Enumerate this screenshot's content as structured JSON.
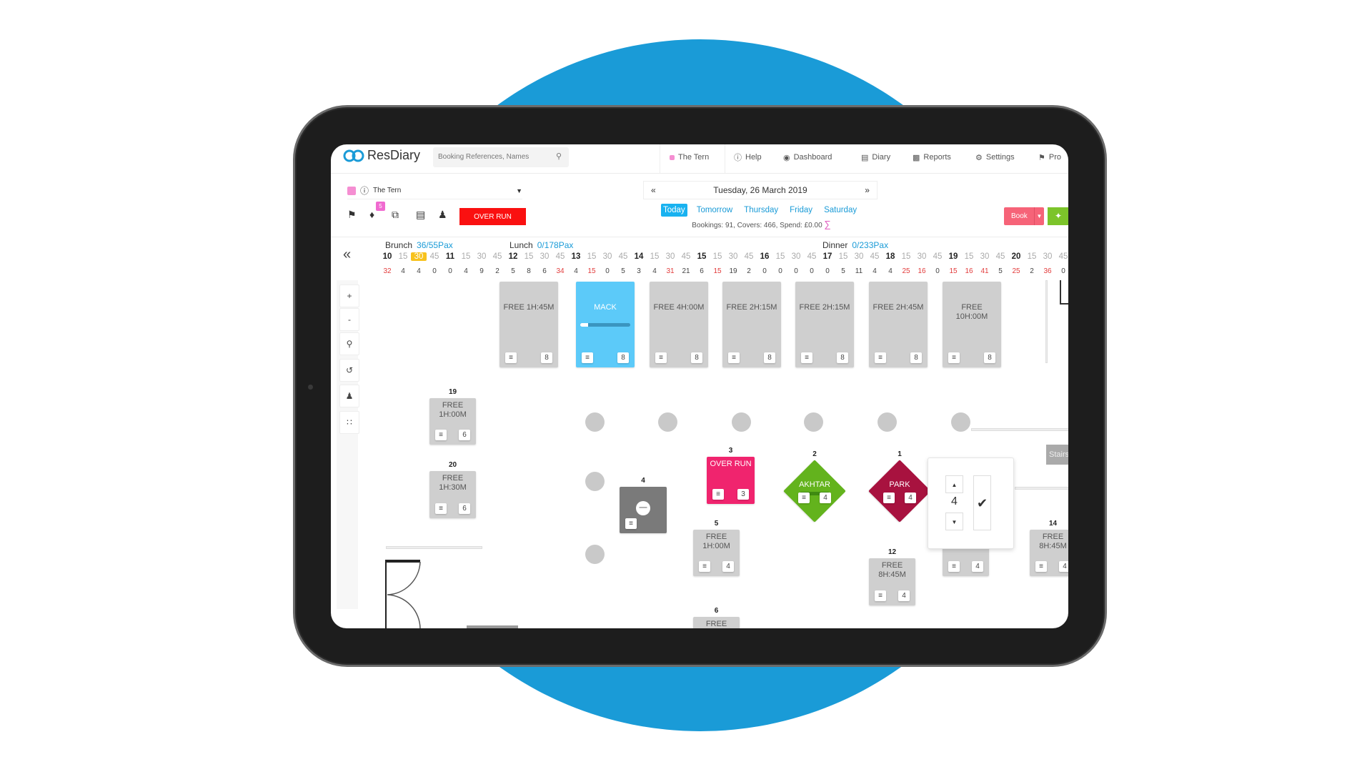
{
  "colors": {
    "background_circle": "#1a9bd7",
    "brand": "#1a9bd7",
    "overrun": "#fa1010",
    "book": "#f66378",
    "walkin": "#7cc42a",
    "mack": "#5ccaf9",
    "table3": "#f0246e",
    "table2": "#63b31d",
    "table1": "#a8123f",
    "blocked": "#7a7a7a"
  },
  "header": {
    "logo_text": "ResDiary",
    "search_placeholder": "Booking References, Names",
    "nav": [
      {
        "label": "The Tern",
        "icon": "pink-dot"
      },
      {
        "label": "Help",
        "icon": "help-icon"
      },
      {
        "label": "Dashboard",
        "icon": "dashboard-icon"
      },
      {
        "label": "Diary",
        "icon": "diary-icon"
      },
      {
        "label": "Reports",
        "icon": "reports-icon"
      },
      {
        "label": "Settings",
        "icon": "gear-icon"
      },
      {
        "label": "Pro",
        "icon": "megaphone-icon"
      }
    ]
  },
  "toolbar": {
    "venue": "The Tern",
    "date": "Tuesday, 26 March 2019",
    "date_tabs": [
      "Today",
      "Tomorrow",
      "Thursday",
      "Friday",
      "Saturday"
    ],
    "active_tab": "Today",
    "summary": "Bookings: 91, Covers: 466, Spend: £0.00",
    "sigma": "∑",
    "tag_badge": "5",
    "overrun_label": "OVER RUN",
    "book_label": "Book"
  },
  "timeline": {
    "shifts": [
      {
        "name": "Brunch",
        "pax": "36/55Pax"
      },
      {
        "name": "Lunch",
        "pax": "0/178Pax"
      },
      {
        "name": "Dinner",
        "pax": "0/233Pax"
      }
    ],
    "slots": [
      "10",
      "15",
      "30",
      "45",
      "11",
      "15",
      "30",
      "45",
      "12",
      "15",
      "30",
      "45",
      "13",
      "15",
      "30",
      "45",
      "14",
      "15",
      "30",
      "45",
      "15",
      "15",
      "30",
      "45",
      "16",
      "15",
      "30",
      "45",
      "17",
      "15",
      "30",
      "45",
      "18",
      "15",
      "30",
      "45",
      "19",
      "15",
      "30",
      "45",
      "20",
      "15",
      "30",
      "45"
    ],
    "current_slot_index": 2,
    "counts": [
      "32",
      "4",
      "4",
      "0",
      "0",
      "4",
      "9",
      "2",
      "5",
      "8",
      "6",
      "34",
      "4",
      "15",
      "0",
      "5",
      "3",
      "4",
      "31",
      "21",
      "6",
      "15",
      "19",
      "2",
      "0",
      "0",
      "0",
      "0",
      "0",
      "5",
      "11",
      "4",
      "4",
      "25",
      "16",
      "0",
      "15",
      "16",
      "41",
      "5",
      "25",
      "2",
      "36",
      "0"
    ],
    "red_counts_index": [
      0,
      11,
      13,
      18,
      21,
      33,
      34,
      36,
      37,
      38,
      40,
      42
    ]
  },
  "side_tools": [
    "zoom-in",
    "zoom-out",
    "search",
    "undo",
    "person",
    "grid"
  ],
  "side_tool_glyphs": [
    "+",
    "-"
  ],
  "tables": [
    {
      "num": "",
      "text": "FREE 1H:45M",
      "cap": "8"
    },
    {
      "num": "",
      "text": "MACK",
      "cap": "8",
      "progress": 0.15
    },
    {
      "num": "",
      "text": "FREE 4H:00M",
      "cap": "8"
    },
    {
      "num": "",
      "text": "FREE 2H:15M",
      "cap": "8"
    },
    {
      "num": "",
      "text": "FREE 2H:15M",
      "cap": "8"
    },
    {
      "num": "",
      "text": "FREE 2H:45M",
      "cap": "8"
    },
    {
      "num": "",
      "text": "FREE 10H:00M",
      "cap": "8"
    },
    {
      "num": "19",
      "text": "FREE 1H:00M",
      "cap": "6"
    },
    {
      "num": "20",
      "text": "FREE 1H:30M",
      "cap": "6"
    },
    {
      "num": "4",
      "text": "",
      "cap": ""
    },
    {
      "num": "3",
      "text": "OVER RUN",
      "cap": "3"
    },
    {
      "num": "2",
      "text": "AKHTAR",
      "cap": "4"
    },
    {
      "num": "1",
      "text": "PARK",
      "cap": "4"
    },
    {
      "num": "5",
      "text": "FREE 1H:00M",
      "cap": "4"
    },
    {
      "num": "12",
      "text": "FREE 8H:45M",
      "cap": "4"
    },
    {
      "num": "",
      "text": "",
      "cap": "4"
    },
    {
      "num": "14",
      "text": "FREE 8H:45M",
      "cap": "4"
    },
    {
      "num": "6",
      "text": "FREE",
      "cap": ""
    }
  ],
  "stairs_label": "Stairs",
  "popup": {
    "value": "4"
  }
}
